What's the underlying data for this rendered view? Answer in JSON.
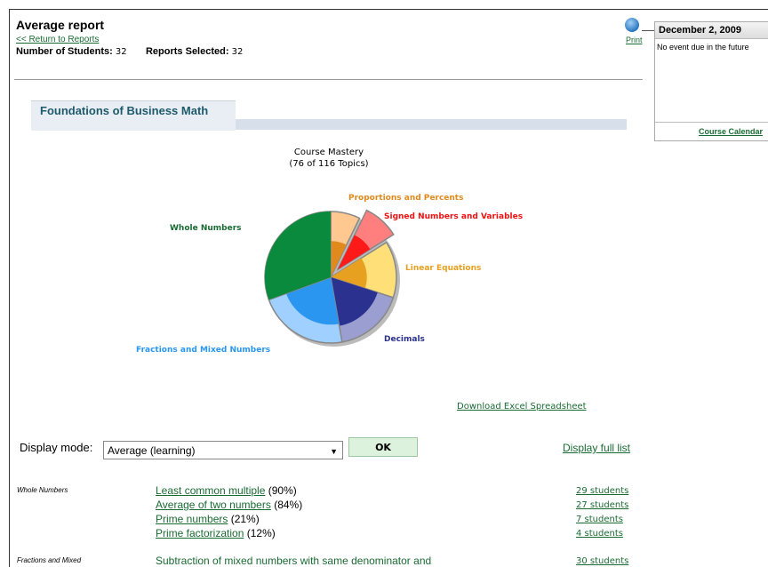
{
  "header": {
    "title": "Average report",
    "return_link": "<< Return to Reports",
    "students_label": "Number of Students:",
    "students_value": "32",
    "reports_label": "Reports Selected:",
    "reports_value": "32",
    "print_label": "Print"
  },
  "calendar": {
    "date": "December 2, 2009",
    "event": "No event due in the future",
    "footer_link": "Course Calendar"
  },
  "course": {
    "title": "Foundations of Business Math"
  },
  "chart_data": {
    "type": "pie",
    "title": "Course Mastery",
    "subtitle": "(76 of 116 Topics)",
    "slices": [
      {
        "label": "Proportions and Percents",
        "color": "#e08a1e"
      },
      {
        "label": "Signed Numbers and Variables",
        "color": "#ff1a1a"
      },
      {
        "label": "Linear Equations",
        "color": "#e8a020"
      },
      {
        "label": "Decimals",
        "color": "#2b318f"
      },
      {
        "label": "Fractions and Mixed Numbers",
        "color": "#2a96f0"
      },
      {
        "label": "Whole Numbers",
        "color": "#0a8a3c"
      }
    ]
  },
  "download_link": "Download Excel Spreadsheet",
  "display": {
    "label": "Display mode:",
    "selected": "Average (learning)",
    "ok_label": "OK",
    "full_list_link": "Display full list"
  },
  "groups": [
    {
      "category": "Whole Numbers",
      "items": [
        {
          "topic": "Least common multiple",
          "pct": "(90%)",
          "students": "29 students"
        },
        {
          "topic": "Average of two numbers",
          "pct": "(84%)",
          "students": "27 students"
        },
        {
          "topic": "Prime numbers",
          "pct": "(21%)",
          "students": "7 students"
        },
        {
          "topic": "Prime factorization",
          "pct": "(12%)",
          "students": "4 students"
        }
      ]
    },
    {
      "category": "Fractions and Mixed",
      "items": [
        {
          "topic": "Subtraction of mixed numbers with same denominator and",
          "pct": "",
          "students": "30 students"
        }
      ]
    }
  ]
}
